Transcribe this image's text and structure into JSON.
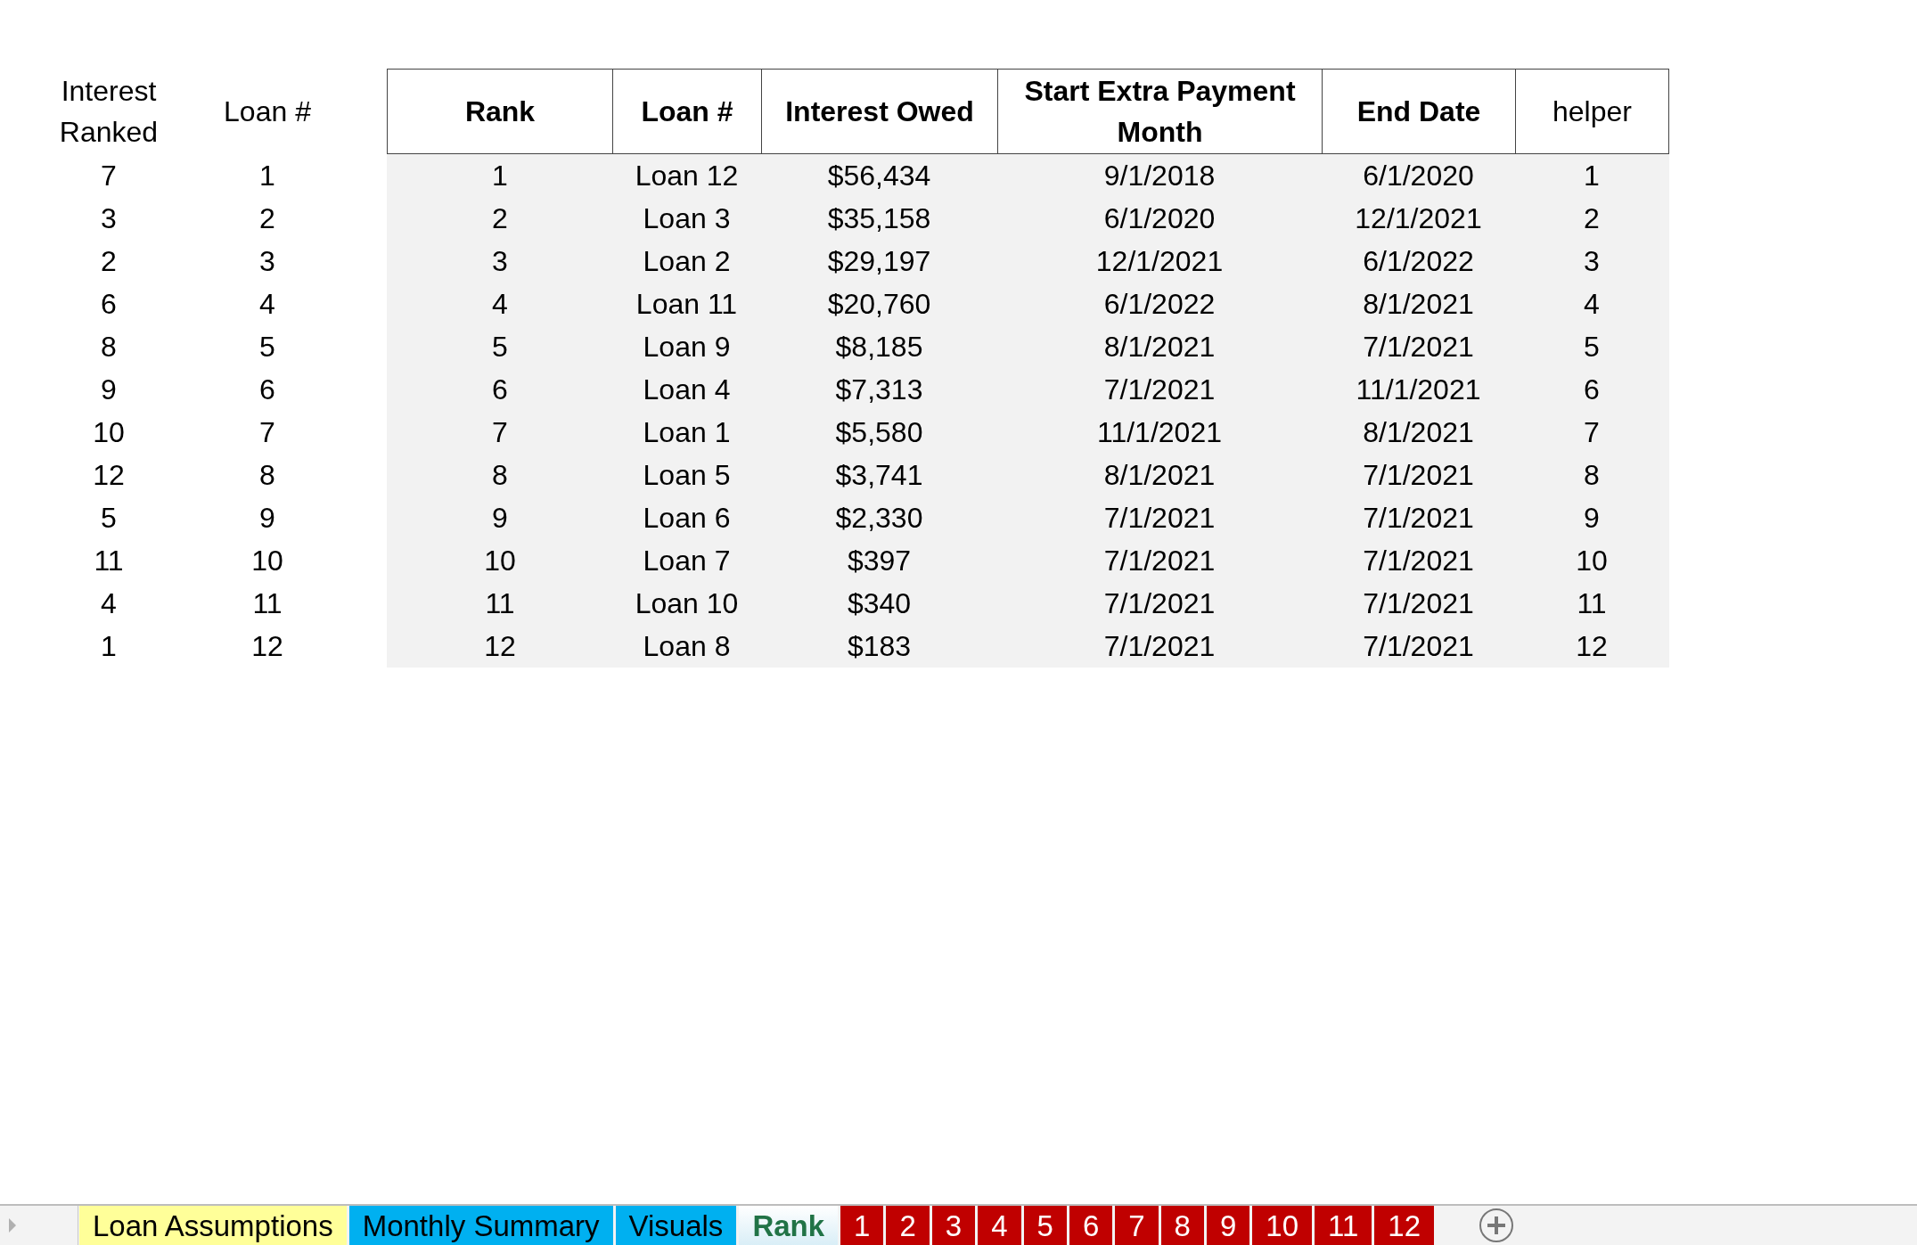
{
  "side_table": {
    "columns": [
      "Interest Ranked",
      "Loan #"
    ],
    "rows": [
      [
        "7",
        "1"
      ],
      [
        "3",
        "2"
      ],
      [
        "2",
        "3"
      ],
      [
        "6",
        "4"
      ],
      [
        "8",
        "5"
      ],
      [
        "9",
        "6"
      ],
      [
        "10",
        "7"
      ],
      [
        "12",
        "8"
      ],
      [
        "5",
        "9"
      ],
      [
        "11",
        "10"
      ],
      [
        "4",
        "11"
      ],
      [
        "1",
        "12"
      ]
    ]
  },
  "table": {
    "columns": [
      {
        "label": "Rank",
        "bold": true
      },
      {
        "label": "Loan #",
        "bold": true
      },
      {
        "label": "Interest Owed",
        "bold": true
      },
      {
        "label": "Start Extra Payment Month",
        "bold": true
      },
      {
        "label": "End Date",
        "bold": true
      },
      {
        "label": "helper",
        "bold": false
      }
    ],
    "rows": [
      [
        "1",
        "Loan 12",
        "$56,434",
        "9/1/2018",
        "6/1/2020",
        "1"
      ],
      [
        "2",
        "Loan 3",
        "$35,158",
        "6/1/2020",
        "12/1/2021",
        "2"
      ],
      [
        "3",
        "Loan 2",
        "$29,197",
        "12/1/2021",
        "6/1/2022",
        "3"
      ],
      [
        "4",
        "Loan 11",
        "$20,760",
        "6/1/2022",
        "8/1/2021",
        "4"
      ],
      [
        "5",
        "Loan 9",
        "$8,185",
        "8/1/2021",
        "7/1/2021",
        "5"
      ],
      [
        "6",
        "Loan 4",
        "$7,313",
        "7/1/2021",
        "11/1/2021",
        "6"
      ],
      [
        "7",
        "Loan 1",
        "$5,580",
        "11/1/2021",
        "8/1/2021",
        "7"
      ],
      [
        "8",
        "Loan 5",
        "$3,741",
        "8/1/2021",
        "7/1/2021",
        "8"
      ],
      [
        "9",
        "Loan 6",
        "$2,330",
        "7/1/2021",
        "7/1/2021",
        "9"
      ],
      [
        "10",
        "Loan 7",
        "$397",
        "7/1/2021",
        "7/1/2021",
        "10"
      ],
      [
        "11",
        "Loan 10",
        "$340",
        "7/1/2021",
        "7/1/2021",
        "11"
      ],
      [
        "12",
        "Loan 8",
        "$183",
        "7/1/2021",
        "7/1/2021",
        "12"
      ]
    ]
  },
  "sheet_tabs": [
    {
      "label": "Loan Assumptions",
      "color": "#ffff99",
      "selected": false
    },
    {
      "label": "Monthly Summary",
      "color": "#00b0f0",
      "selected": false
    },
    {
      "label": "Visuals",
      "color": "#00b0f0",
      "selected": false
    },
    {
      "label": "Rank",
      "color": "#ffffff",
      "selected": true
    },
    {
      "label": "1",
      "color": "#c00000",
      "selected": false
    },
    {
      "label": "2",
      "color": "#c00000",
      "selected": false
    },
    {
      "label": "3",
      "color": "#c00000",
      "selected": false
    },
    {
      "label": "4",
      "color": "#c00000",
      "selected": false
    },
    {
      "label": "5",
      "color": "#c00000",
      "selected": false
    },
    {
      "label": "6",
      "color": "#c00000",
      "selected": false
    },
    {
      "label": "7",
      "color": "#c00000",
      "selected": false
    },
    {
      "label": "8",
      "color": "#c00000",
      "selected": false
    },
    {
      "label": "9",
      "color": "#c00000",
      "selected": false
    },
    {
      "label": "10",
      "color": "#c00000",
      "selected": false
    },
    {
      "label": "11",
      "color": "#c00000",
      "selected": false
    },
    {
      "label": "12",
      "color": "#c00000",
      "selected": false
    }
  ]
}
